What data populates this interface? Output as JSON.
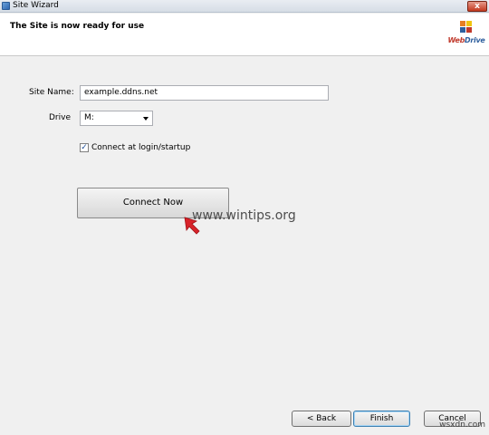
{
  "window": {
    "title": "Site Wizard",
    "close_label": "x"
  },
  "header": {
    "title": "The Site is now ready for use"
  },
  "logo": {
    "text_web": "Web",
    "text_drive": "Drive"
  },
  "form": {
    "site_name_label": "Site Name:",
    "site_name_value": "example.ddns.net",
    "drive_label": "Drive",
    "drive_value": "M:",
    "connect_checkbox_label": "Connect at login/startup",
    "connect_checked": true
  },
  "buttons": {
    "connect_now": "Connect Now",
    "back": "< Back",
    "finish": "Finish",
    "cancel": "Cancel"
  },
  "watermarks": {
    "site": "www.wintips.org",
    "corner": "wsxdn.com"
  },
  "colors": {
    "accent_red": "#d8232a",
    "logo_red": "#c0392b",
    "logo_blue": "#2e5f9e"
  }
}
